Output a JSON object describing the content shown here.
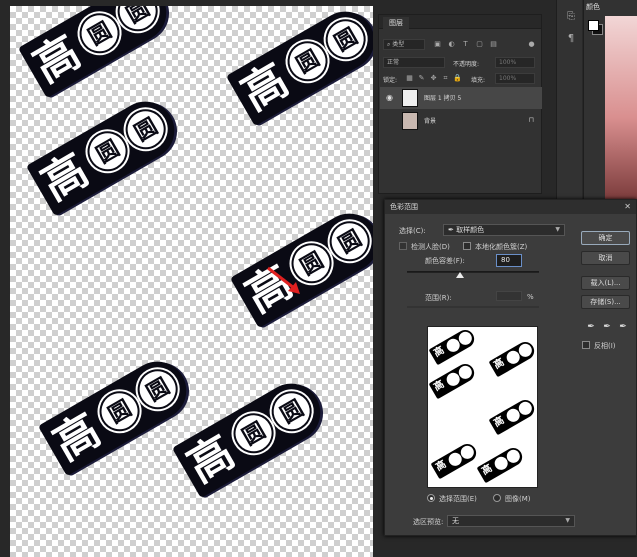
{
  "layers_panel": {
    "tab": "图层",
    "filter_kind": "类型",
    "blend_mode": "正常",
    "opacity_label": "不透明度:",
    "opacity_value": "100%",
    "lock_label": "锁定:",
    "fill_label": "填充:",
    "fill_value": "100%",
    "layers": [
      {
        "name": "图层 1 拷贝 5",
        "selected": true
      },
      {
        "name": "背景",
        "selected": false
      }
    ]
  },
  "color_panel": {
    "tab": "颜色"
  },
  "canvas": {
    "sticker_text": [
      "高",
      "圆",
      "圆"
    ]
  },
  "dialog": {
    "title": "色彩范围",
    "select_label": "选择(C):",
    "select_value": "取样颜色",
    "detect_faces": "检测人脸(D)",
    "localized": "本地化颜色簇(Z)",
    "fuzziness_label": "颜色容差(F):",
    "fuzziness_value": "80",
    "range_label": "范围(R):",
    "range_unit": "%",
    "radio_selection": "选择范围(E)",
    "radio_image": "图像(M)",
    "preview_label": "选区预览:",
    "preview_value": "无",
    "buttons": {
      "ok": "确定",
      "cancel": "取消",
      "load": "载入(L)...",
      "save": "存储(S)..."
    },
    "invert": "反相(I)"
  }
}
